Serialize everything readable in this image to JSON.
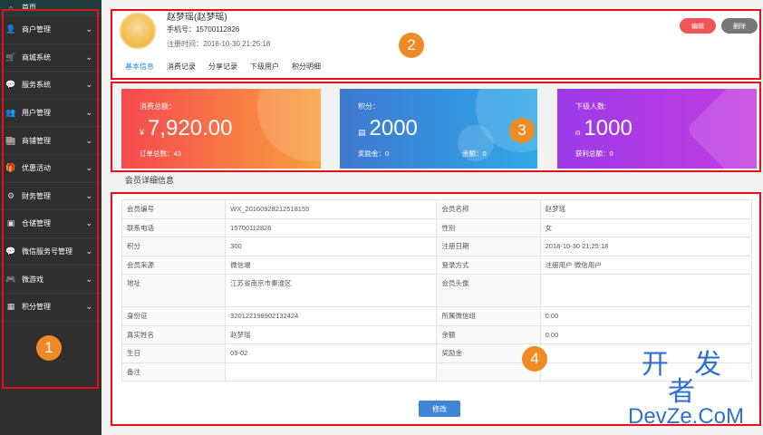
{
  "sidebar": {
    "items": [
      {
        "icon": "home-icon",
        "glyph": "⌂",
        "label": "首页",
        "chevron": false
      },
      {
        "icon": "user-icon",
        "glyph": "👤",
        "label": "商户管理",
        "chevron": true
      },
      {
        "icon": "cart-icon",
        "glyph": "🛒",
        "label": "商城系统",
        "chevron": true
      },
      {
        "icon": "chat-icon",
        "glyph": "💬",
        "label": "服务系统",
        "chevron": true
      },
      {
        "icon": "users-icon",
        "glyph": "👥",
        "label": "用户管理",
        "chevron": true
      },
      {
        "icon": "shop-icon",
        "glyph": "🏬",
        "label": "商铺管理",
        "chevron": true
      },
      {
        "icon": "gift-icon",
        "glyph": "🎁",
        "label": "优惠活动",
        "chevron": true
      },
      {
        "icon": "gear-icon",
        "glyph": "⚙",
        "label": "财务管理",
        "chevron": true
      },
      {
        "icon": "warehouse-icon",
        "glyph": "▣",
        "label": "仓储管理",
        "chevron": true
      },
      {
        "icon": "wechat-icon",
        "glyph": "💬",
        "label": "微信服务号管理",
        "chevron": true
      },
      {
        "icon": "game-icon",
        "glyph": "🎮",
        "label": "微游戏",
        "chevron": true
      },
      {
        "icon": "grid-icon",
        "glyph": "▦",
        "label": "积分管理",
        "chevron": true
      }
    ]
  },
  "profile": {
    "name": "赵梦瑶(赵梦瑶)",
    "phone": "手机号：15700112826",
    "register_time": "注册时间：2018-10-30  21:25:18",
    "edit_label": "编辑",
    "delete_label": "删除",
    "tabs": [
      "基本信息",
      "消费记录",
      "分享记录",
      "下级用户",
      "积分明细"
    ]
  },
  "cards": [
    {
      "label": "消费总额：",
      "prefix": "¥",
      "value": "7,920.00",
      "sub1": "订单总数：43",
      "sub2": ""
    },
    {
      "label": "积分：",
      "prefix": "▤",
      "value": "2000",
      "sub1": "奖励金：0",
      "sub2": "余额：0"
    },
    {
      "label": "下级人数:",
      "prefix": "⍝",
      "value": "1000",
      "sub1": "获利总额：0",
      "sub2": ""
    }
  ],
  "section_title": "会员详细信息",
  "detail_rows": [
    [
      "会员编号",
      "WX_20160928212518155",
      "会员名称",
      "赵梦瑶"
    ],
    [
      "联系电话",
      "15700112826",
      "性别",
      "女"
    ],
    [
      "积分",
      "300",
      "注册日期",
      "2018-10-30  21:25:18"
    ],
    [
      "会员来源",
      "微信端",
      "登录方式",
      "注册用户  微信用户"
    ],
    [
      "地址",
      "江苏省南京市秦淮区",
      "会员头像",
      ""
    ],
    [
      "身份证",
      "320122198902132424",
      "所属微信组",
      "0.00"
    ],
    [
      "真实姓名",
      "赵梦瑶",
      "余额",
      "0.00"
    ],
    [
      "生日",
      "09-02",
      "奖励金",
      ""
    ],
    [
      "备注",
      "",
      "",
      ""
    ]
  ],
  "modify_label": "修改",
  "annotations": [
    "1",
    "2",
    "3",
    "4"
  ],
  "watermark": {
    "line1": "开 发 者",
    "line2": "DevZe.CoM"
  },
  "colors": {
    "highlight": "#e5101c",
    "marker": "#f08a24",
    "accent": "#2c8be8"
  }
}
